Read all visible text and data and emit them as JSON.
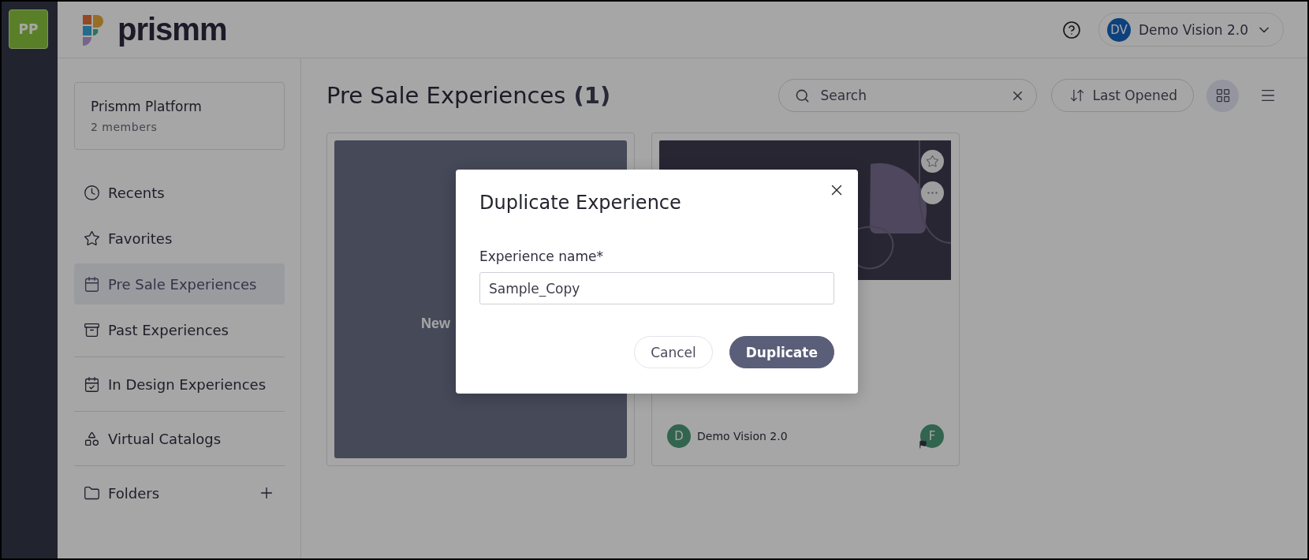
{
  "rail": {
    "workspace_initials": "PP"
  },
  "header": {
    "logo_text": "prismm",
    "user": {
      "initials": "DV",
      "name": "Demo Vision 2.0"
    }
  },
  "sidebar": {
    "workspace": {
      "name": "Prismm Platform",
      "members": "2 members"
    },
    "sections": [
      [
        {
          "kind": "recents",
          "label": "Recents",
          "selected": false
        },
        {
          "kind": "favorites",
          "label": "Favorites",
          "selected": false
        },
        {
          "kind": "calendar",
          "label": "Pre Sale Experiences",
          "selected": true
        },
        {
          "kind": "archive",
          "label": "Past Experiences",
          "selected": false
        }
      ],
      [
        {
          "kind": "checked",
          "label": "In Design Experiences",
          "selected": false
        }
      ],
      [
        {
          "kind": "catalog",
          "label": "Virtual Catalogs",
          "selected": false
        }
      ]
    ],
    "folders": {
      "label": "Folders"
    }
  },
  "main": {
    "title": "Pre Sale Experiences",
    "count": "(1)",
    "search": {
      "placeholder": "Search"
    },
    "sort": {
      "label": "Last Opened"
    },
    "views": [
      {
        "kind": "grid",
        "selected": true
      },
      {
        "kind": "list",
        "selected": false
      }
    ],
    "cards": [
      {
        "kind": "new",
        "label": "New"
      },
      {
        "kind": "experience",
        "owner_initial": "D",
        "owner_name": "Demo Vision 2.0",
        "collaborator_initial": "F"
      }
    ]
  },
  "dialog": {
    "title": "Duplicate Experience",
    "field_label": "Experience name*",
    "field_value": "Sample_Copy",
    "buttons": [
      {
        "kind": "secondary",
        "label": "Cancel"
      },
      {
        "kind": "primary",
        "label": "Duplicate"
      }
    ]
  }
}
